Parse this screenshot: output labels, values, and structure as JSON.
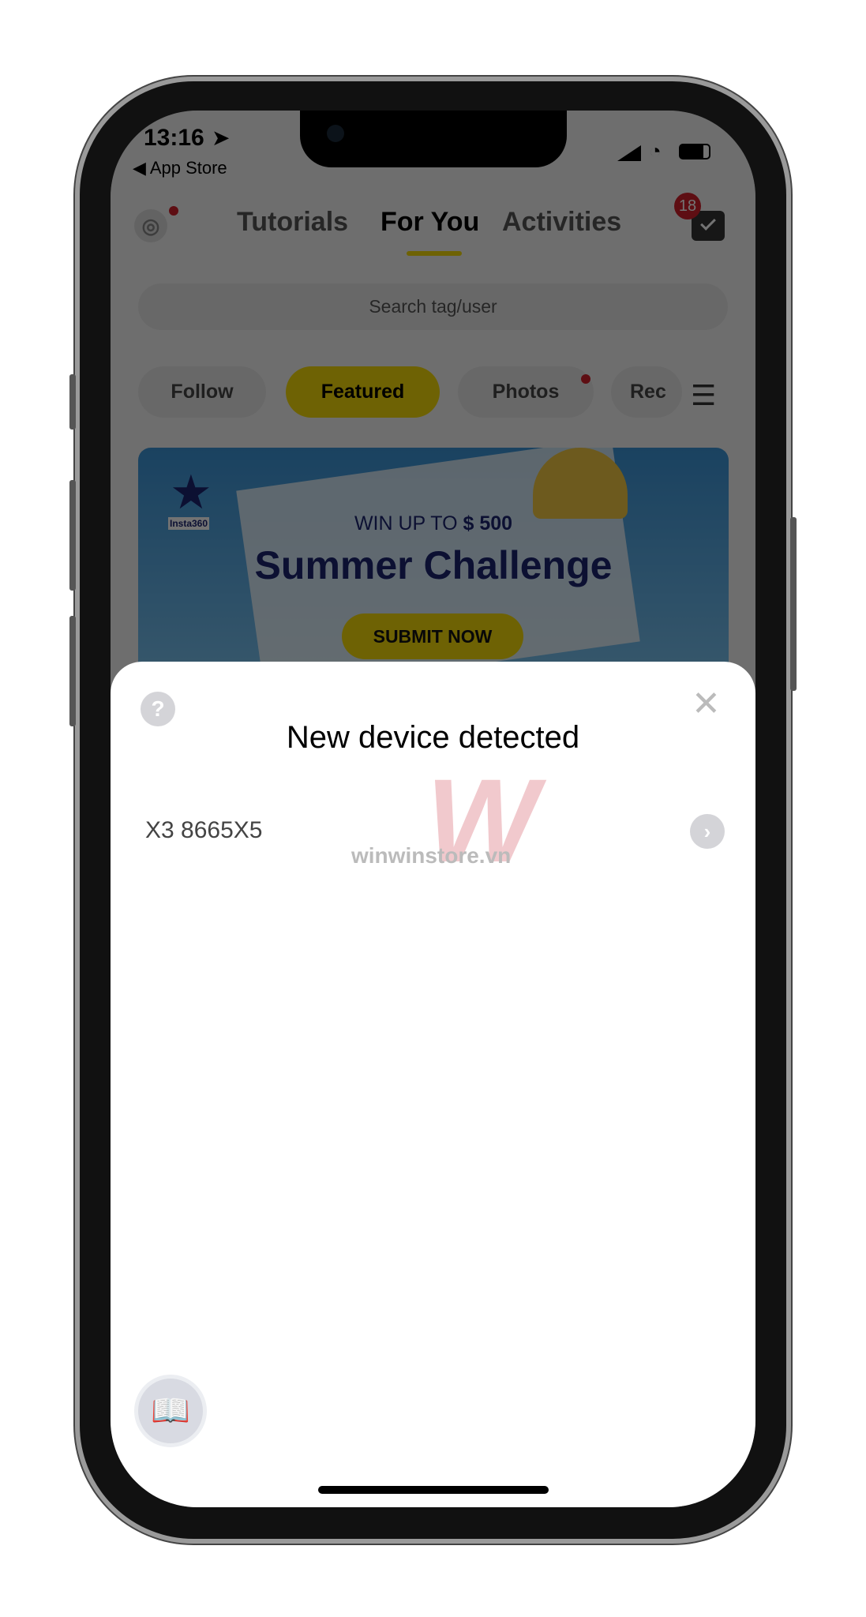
{
  "status_bar": {
    "time": "13:16",
    "back_label": "◀ App Store"
  },
  "header": {
    "tabs": [
      {
        "label": "Tutorials"
      },
      {
        "label": "For You",
        "active": true
      },
      {
        "label": "Activities"
      }
    ],
    "inbox_badge": "18"
  },
  "search": {
    "placeholder": "Search tag/user"
  },
  "chips": [
    {
      "label": "Follow"
    },
    {
      "label": "Featured",
      "active": true
    },
    {
      "label": "Photos"
    },
    {
      "label": "Rec"
    }
  ],
  "banner": {
    "brand": "Insta360",
    "subtitle_prefix": "WIN UP TO ",
    "subtitle_amount": "$ 500",
    "title": "Summer Challenge",
    "cta": "SUBMIT NOW"
  },
  "sheet": {
    "title": "New device detected",
    "devices": [
      {
        "name": "X3 8665X5"
      }
    ]
  },
  "watermark": "winwinstore.vn",
  "colors": {
    "accent": "#f5d90a",
    "badge": "#d0202a",
    "banner_text": "#1a2370"
  }
}
